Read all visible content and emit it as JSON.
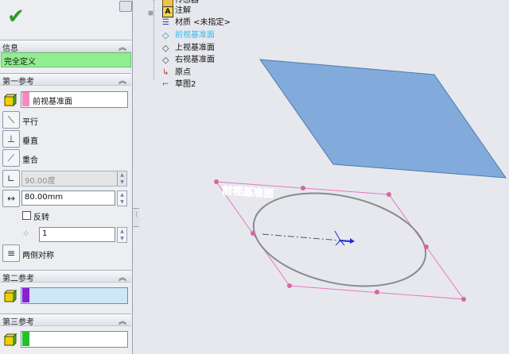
{
  "property_manager": {
    "sections": {
      "info": "信息",
      "ref1": "第一参考",
      "ref2": "第二参考",
      "ref3": "第三参考"
    },
    "status": "完全定义",
    "ref1": {
      "selection": "前视基准面",
      "options": {
        "parallel": "平行",
        "perpendicular": "垂直",
        "coincident": "重合"
      },
      "angle_value": "90.00度",
      "distance_value": "80.00mm",
      "flip_label": "反转",
      "count_value": "1",
      "mid_plane": "两侧对称"
    },
    "ref2": {
      "selection": ""
    },
    "ref3": {
      "selection": ""
    },
    "colors": {
      "status_bg": "#90ee90",
      "ref1_swatch": "#f08cc0",
      "ref2_swatch": "#8a1fd6",
      "ref3_swatch": "#22c02c",
      "plane_fill": "#82abdc",
      "plane_pink": "#e778b8"
    }
  },
  "feature_tree": {
    "items": [
      {
        "label": "传感器",
        "icon": "sensor-icon"
      },
      {
        "label": "注解",
        "icon": "annotation-icon"
      },
      {
        "label": "材质 <未指定>",
        "icon": "material-icon"
      },
      {
        "label": "前视基准面",
        "icon": "plane-icon",
        "highlighted": true
      },
      {
        "label": "上视基准面",
        "icon": "plane-icon"
      },
      {
        "label": "右视基准面",
        "icon": "plane-icon"
      },
      {
        "label": "原点",
        "icon": "origin-icon"
      },
      {
        "label": "草图2",
        "icon": "sketch-icon"
      }
    ]
  },
  "viewport": {
    "plane_label": "前视基准面"
  }
}
